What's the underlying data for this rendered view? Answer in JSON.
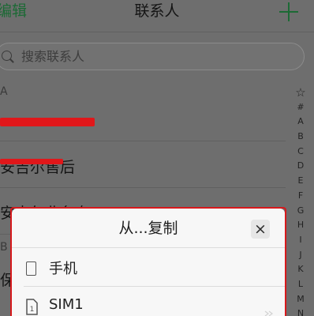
{
  "header": {
    "edit_label": "编辑",
    "title": "联系人",
    "add_icon": "plus-icon"
  },
  "search": {
    "placeholder": "搜索联系人",
    "icon": "search-icon"
  },
  "contacts": {
    "sections": [
      {
        "letter": "A",
        "entries": [
          {
            "redacted": true
          },
          {
            "name": "安吉尔售后",
            "redacted": true
          },
          {
            "name": "安吉尔业务专"
          }
        ]
      },
      {
        "letter": "B",
        "entries": [
          {
            "name": "保"
          }
        ]
      }
    ]
  },
  "index": [
    "☆",
    "#",
    "A",
    "B",
    "C",
    "D",
    "E",
    "F",
    "G",
    "H",
    "I",
    "J",
    "K",
    "L",
    "M",
    "N"
  ],
  "dialog": {
    "title": "从...复制",
    "close_label": "×",
    "close_icon": "close-icon",
    "options": [
      {
        "label": "手机",
        "icon": "phone-icon"
      },
      {
        "label": "SIM1",
        "icon": "sim-card-icon",
        "sim_number": "1",
        "trailing_icon": "chevron-right-icon"
      }
    ]
  },
  "colors": {
    "page_background": "#6e6e6e",
    "text_color": "#141414",
    "accent": "#1c6a35",
    "redaction": "#e0171a",
    "outline": "#d7191c",
    "dialog_background": "#f7f7f7"
  }
}
